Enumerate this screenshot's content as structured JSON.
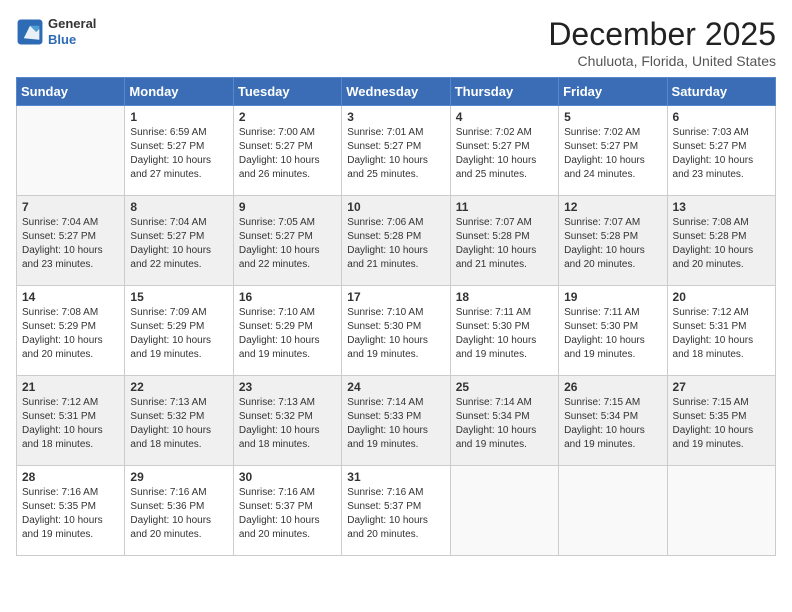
{
  "header": {
    "logo": {
      "general": "General",
      "blue": "Blue"
    },
    "month": "December 2025",
    "location": "Chuluota, Florida, United States"
  },
  "days_of_week": [
    "Sunday",
    "Monday",
    "Tuesday",
    "Wednesday",
    "Thursday",
    "Friday",
    "Saturday"
  ],
  "weeks": [
    [
      {
        "day": "",
        "info": ""
      },
      {
        "day": "1",
        "info": "Sunrise: 6:59 AM\nSunset: 5:27 PM\nDaylight: 10 hours\nand 27 minutes."
      },
      {
        "day": "2",
        "info": "Sunrise: 7:00 AM\nSunset: 5:27 PM\nDaylight: 10 hours\nand 26 minutes."
      },
      {
        "day": "3",
        "info": "Sunrise: 7:01 AM\nSunset: 5:27 PM\nDaylight: 10 hours\nand 25 minutes."
      },
      {
        "day": "4",
        "info": "Sunrise: 7:02 AM\nSunset: 5:27 PM\nDaylight: 10 hours\nand 25 minutes."
      },
      {
        "day": "5",
        "info": "Sunrise: 7:02 AM\nSunset: 5:27 PM\nDaylight: 10 hours\nand 24 minutes."
      },
      {
        "day": "6",
        "info": "Sunrise: 7:03 AM\nSunset: 5:27 PM\nDaylight: 10 hours\nand 23 minutes."
      }
    ],
    [
      {
        "day": "7",
        "info": "Sunrise: 7:04 AM\nSunset: 5:27 PM\nDaylight: 10 hours\nand 23 minutes."
      },
      {
        "day": "8",
        "info": "Sunrise: 7:04 AM\nSunset: 5:27 PM\nDaylight: 10 hours\nand 22 minutes."
      },
      {
        "day": "9",
        "info": "Sunrise: 7:05 AM\nSunset: 5:27 PM\nDaylight: 10 hours\nand 22 minutes."
      },
      {
        "day": "10",
        "info": "Sunrise: 7:06 AM\nSunset: 5:28 PM\nDaylight: 10 hours\nand 21 minutes."
      },
      {
        "day": "11",
        "info": "Sunrise: 7:07 AM\nSunset: 5:28 PM\nDaylight: 10 hours\nand 21 minutes."
      },
      {
        "day": "12",
        "info": "Sunrise: 7:07 AM\nSunset: 5:28 PM\nDaylight: 10 hours\nand 20 minutes."
      },
      {
        "day": "13",
        "info": "Sunrise: 7:08 AM\nSunset: 5:28 PM\nDaylight: 10 hours\nand 20 minutes."
      }
    ],
    [
      {
        "day": "14",
        "info": "Sunrise: 7:08 AM\nSunset: 5:29 PM\nDaylight: 10 hours\nand 20 minutes."
      },
      {
        "day": "15",
        "info": "Sunrise: 7:09 AM\nSunset: 5:29 PM\nDaylight: 10 hours\nand 19 minutes."
      },
      {
        "day": "16",
        "info": "Sunrise: 7:10 AM\nSunset: 5:29 PM\nDaylight: 10 hours\nand 19 minutes."
      },
      {
        "day": "17",
        "info": "Sunrise: 7:10 AM\nSunset: 5:30 PM\nDaylight: 10 hours\nand 19 minutes."
      },
      {
        "day": "18",
        "info": "Sunrise: 7:11 AM\nSunset: 5:30 PM\nDaylight: 10 hours\nand 19 minutes."
      },
      {
        "day": "19",
        "info": "Sunrise: 7:11 AM\nSunset: 5:30 PM\nDaylight: 10 hours\nand 19 minutes."
      },
      {
        "day": "20",
        "info": "Sunrise: 7:12 AM\nSunset: 5:31 PM\nDaylight: 10 hours\nand 18 minutes."
      }
    ],
    [
      {
        "day": "21",
        "info": "Sunrise: 7:12 AM\nSunset: 5:31 PM\nDaylight: 10 hours\nand 18 minutes."
      },
      {
        "day": "22",
        "info": "Sunrise: 7:13 AM\nSunset: 5:32 PM\nDaylight: 10 hours\nand 18 minutes."
      },
      {
        "day": "23",
        "info": "Sunrise: 7:13 AM\nSunset: 5:32 PM\nDaylight: 10 hours\nand 18 minutes."
      },
      {
        "day": "24",
        "info": "Sunrise: 7:14 AM\nSunset: 5:33 PM\nDaylight: 10 hours\nand 19 minutes."
      },
      {
        "day": "25",
        "info": "Sunrise: 7:14 AM\nSunset: 5:34 PM\nDaylight: 10 hours\nand 19 minutes."
      },
      {
        "day": "26",
        "info": "Sunrise: 7:15 AM\nSunset: 5:34 PM\nDaylight: 10 hours\nand 19 minutes."
      },
      {
        "day": "27",
        "info": "Sunrise: 7:15 AM\nSunset: 5:35 PM\nDaylight: 10 hours\nand 19 minutes."
      }
    ],
    [
      {
        "day": "28",
        "info": "Sunrise: 7:16 AM\nSunset: 5:35 PM\nDaylight: 10 hours\nand 19 minutes."
      },
      {
        "day": "29",
        "info": "Sunrise: 7:16 AM\nSunset: 5:36 PM\nDaylight: 10 hours\nand 20 minutes."
      },
      {
        "day": "30",
        "info": "Sunrise: 7:16 AM\nSunset: 5:37 PM\nDaylight: 10 hours\nand 20 minutes."
      },
      {
        "day": "31",
        "info": "Sunrise: 7:16 AM\nSunset: 5:37 PM\nDaylight: 10 hours\nand 20 minutes."
      },
      {
        "day": "",
        "info": ""
      },
      {
        "day": "",
        "info": ""
      },
      {
        "day": "",
        "info": ""
      }
    ]
  ]
}
